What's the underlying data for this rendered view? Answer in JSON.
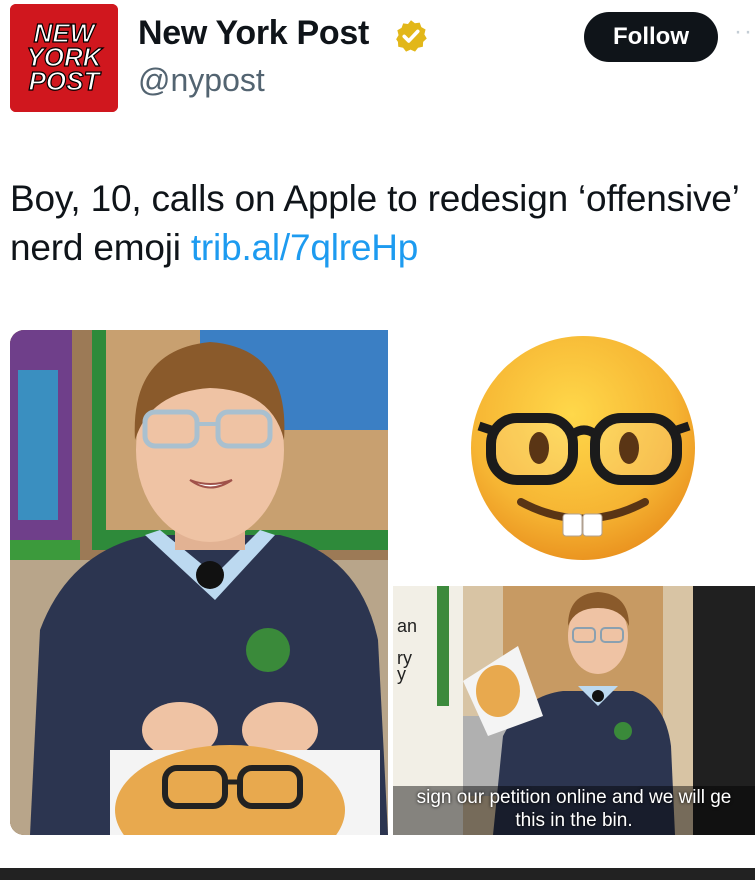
{
  "account": {
    "logo_text": [
      "NEW",
      "YORK",
      "POST"
    ],
    "display_name": "New York Post",
    "handle": "@nypost",
    "verified": true,
    "brand_color": "#d0171e",
    "verified_color": "#e2b719"
  },
  "actions": {
    "follow_label": "Follow",
    "more_icon": "more-options-icon"
  },
  "tweet": {
    "text": "Boy, 10, calls on Apple to redesign ‘offensive’ nerd emoji ",
    "link": "trib.al/7qlreHp",
    "link_color": "#1d9bf0"
  },
  "media": {
    "video_caption_line1": "sign our petition online and we will ge",
    "video_caption_line2": "this in the bin.",
    "wall_sign_text": [
      "an",
      "ry",
      "y"
    ]
  }
}
